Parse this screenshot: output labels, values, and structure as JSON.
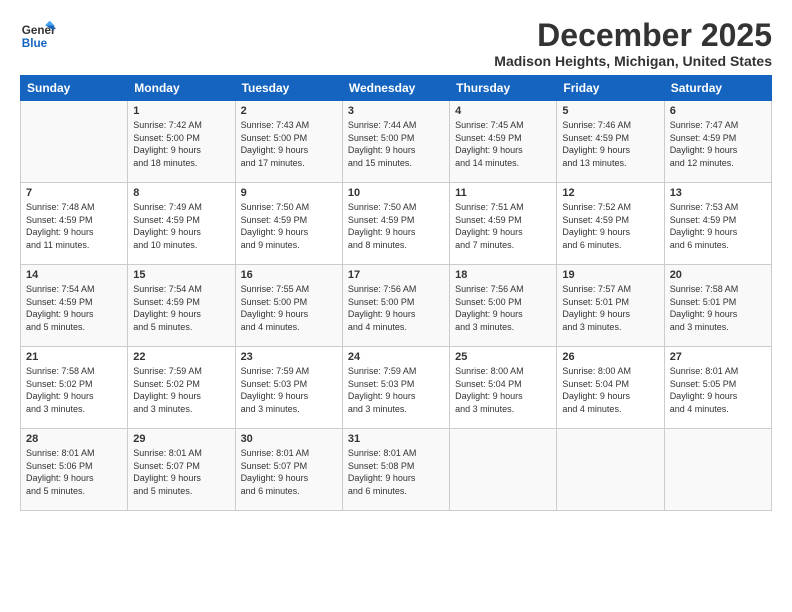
{
  "logo": {
    "line1": "General",
    "line2": "Blue"
  },
  "title": "December 2025",
  "subtitle": "Madison Heights, Michigan, United States",
  "days_header": [
    "Sunday",
    "Monday",
    "Tuesday",
    "Wednesday",
    "Thursday",
    "Friday",
    "Saturday"
  ],
  "weeks": [
    [
      {
        "num": "",
        "info": ""
      },
      {
        "num": "1",
        "info": "Sunrise: 7:42 AM\nSunset: 5:00 PM\nDaylight: 9 hours\nand 18 minutes."
      },
      {
        "num": "2",
        "info": "Sunrise: 7:43 AM\nSunset: 5:00 PM\nDaylight: 9 hours\nand 17 minutes."
      },
      {
        "num": "3",
        "info": "Sunrise: 7:44 AM\nSunset: 5:00 PM\nDaylight: 9 hours\nand 15 minutes."
      },
      {
        "num": "4",
        "info": "Sunrise: 7:45 AM\nSunset: 4:59 PM\nDaylight: 9 hours\nand 14 minutes."
      },
      {
        "num": "5",
        "info": "Sunrise: 7:46 AM\nSunset: 4:59 PM\nDaylight: 9 hours\nand 13 minutes."
      },
      {
        "num": "6",
        "info": "Sunrise: 7:47 AM\nSunset: 4:59 PM\nDaylight: 9 hours\nand 12 minutes."
      }
    ],
    [
      {
        "num": "7",
        "info": "Sunrise: 7:48 AM\nSunset: 4:59 PM\nDaylight: 9 hours\nand 11 minutes."
      },
      {
        "num": "8",
        "info": "Sunrise: 7:49 AM\nSunset: 4:59 PM\nDaylight: 9 hours\nand 10 minutes."
      },
      {
        "num": "9",
        "info": "Sunrise: 7:50 AM\nSunset: 4:59 PM\nDaylight: 9 hours\nand 9 minutes."
      },
      {
        "num": "10",
        "info": "Sunrise: 7:50 AM\nSunset: 4:59 PM\nDaylight: 9 hours\nand 8 minutes."
      },
      {
        "num": "11",
        "info": "Sunrise: 7:51 AM\nSunset: 4:59 PM\nDaylight: 9 hours\nand 7 minutes."
      },
      {
        "num": "12",
        "info": "Sunrise: 7:52 AM\nSunset: 4:59 PM\nDaylight: 9 hours\nand 6 minutes."
      },
      {
        "num": "13",
        "info": "Sunrise: 7:53 AM\nSunset: 4:59 PM\nDaylight: 9 hours\nand 6 minutes."
      }
    ],
    [
      {
        "num": "14",
        "info": "Sunrise: 7:54 AM\nSunset: 4:59 PM\nDaylight: 9 hours\nand 5 minutes."
      },
      {
        "num": "15",
        "info": "Sunrise: 7:54 AM\nSunset: 4:59 PM\nDaylight: 9 hours\nand 5 minutes."
      },
      {
        "num": "16",
        "info": "Sunrise: 7:55 AM\nSunset: 5:00 PM\nDaylight: 9 hours\nand 4 minutes."
      },
      {
        "num": "17",
        "info": "Sunrise: 7:56 AM\nSunset: 5:00 PM\nDaylight: 9 hours\nand 4 minutes."
      },
      {
        "num": "18",
        "info": "Sunrise: 7:56 AM\nSunset: 5:00 PM\nDaylight: 9 hours\nand 3 minutes."
      },
      {
        "num": "19",
        "info": "Sunrise: 7:57 AM\nSunset: 5:01 PM\nDaylight: 9 hours\nand 3 minutes."
      },
      {
        "num": "20",
        "info": "Sunrise: 7:58 AM\nSunset: 5:01 PM\nDaylight: 9 hours\nand 3 minutes."
      }
    ],
    [
      {
        "num": "21",
        "info": "Sunrise: 7:58 AM\nSunset: 5:02 PM\nDaylight: 9 hours\nand 3 minutes."
      },
      {
        "num": "22",
        "info": "Sunrise: 7:59 AM\nSunset: 5:02 PM\nDaylight: 9 hours\nand 3 minutes."
      },
      {
        "num": "23",
        "info": "Sunrise: 7:59 AM\nSunset: 5:03 PM\nDaylight: 9 hours\nand 3 minutes."
      },
      {
        "num": "24",
        "info": "Sunrise: 7:59 AM\nSunset: 5:03 PM\nDaylight: 9 hours\nand 3 minutes."
      },
      {
        "num": "25",
        "info": "Sunrise: 8:00 AM\nSunset: 5:04 PM\nDaylight: 9 hours\nand 3 minutes."
      },
      {
        "num": "26",
        "info": "Sunrise: 8:00 AM\nSunset: 5:04 PM\nDaylight: 9 hours\nand 4 minutes."
      },
      {
        "num": "27",
        "info": "Sunrise: 8:01 AM\nSunset: 5:05 PM\nDaylight: 9 hours\nand 4 minutes."
      }
    ],
    [
      {
        "num": "28",
        "info": "Sunrise: 8:01 AM\nSunset: 5:06 PM\nDaylight: 9 hours\nand 5 minutes."
      },
      {
        "num": "29",
        "info": "Sunrise: 8:01 AM\nSunset: 5:07 PM\nDaylight: 9 hours\nand 5 minutes."
      },
      {
        "num": "30",
        "info": "Sunrise: 8:01 AM\nSunset: 5:07 PM\nDaylight: 9 hours\nand 6 minutes."
      },
      {
        "num": "31",
        "info": "Sunrise: 8:01 AM\nSunset: 5:08 PM\nDaylight: 9 hours\nand 6 minutes."
      },
      {
        "num": "",
        "info": ""
      },
      {
        "num": "",
        "info": ""
      },
      {
        "num": "",
        "info": ""
      }
    ]
  ]
}
